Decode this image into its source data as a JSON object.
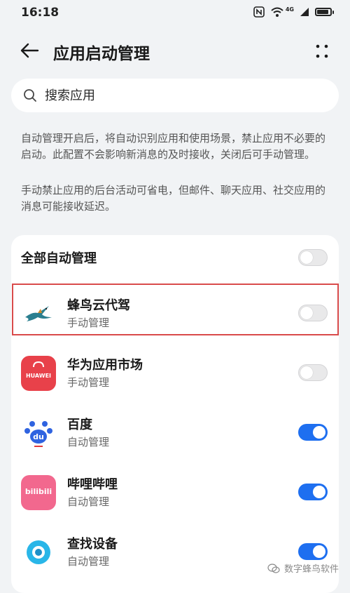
{
  "status": {
    "time": "16:18",
    "network": "4G"
  },
  "header": {
    "title": "应用启动管理"
  },
  "search": {
    "placeholder": "搜索应用"
  },
  "description": {
    "p1": "自动管理开启后，将自动识别应用和使用场景，禁止应用不必要的启动。此配置不会影响新消息的及时接收，关闭后可手动管理。",
    "p2": "手动禁止应用的后台活动可省电，但邮件、聊天应用、社交应用的消息可能接收延迟。"
  },
  "all_auto": {
    "label": "全部自动管理",
    "enabled": false
  },
  "apps": [
    {
      "name": "蜂鸟云代驾",
      "mode": "手动管理",
      "enabled": false,
      "icon": "hummingbird-icon"
    },
    {
      "name": "华为应用市场",
      "mode": "手动管理",
      "enabled": false,
      "icon": "huawei-appgallery-icon",
      "icon_text": "HUAWEI"
    },
    {
      "name": "百度",
      "mode": "自动管理",
      "enabled": true,
      "icon": "baidu-icon",
      "icon_text": "du"
    },
    {
      "name": "哔哩哔哩",
      "mode": "自动管理",
      "enabled": true,
      "icon": "bilibili-icon",
      "icon_text": "bilibili"
    },
    {
      "name": "查找设备",
      "mode": "自动管理",
      "enabled": true,
      "icon": "find-device-icon"
    }
  ],
  "watermark": {
    "text": "数字蜂鸟软件"
  },
  "colors": {
    "accent": "#1e6ff0",
    "highlight": "#d94b4b",
    "background": "#f1f3f5"
  }
}
